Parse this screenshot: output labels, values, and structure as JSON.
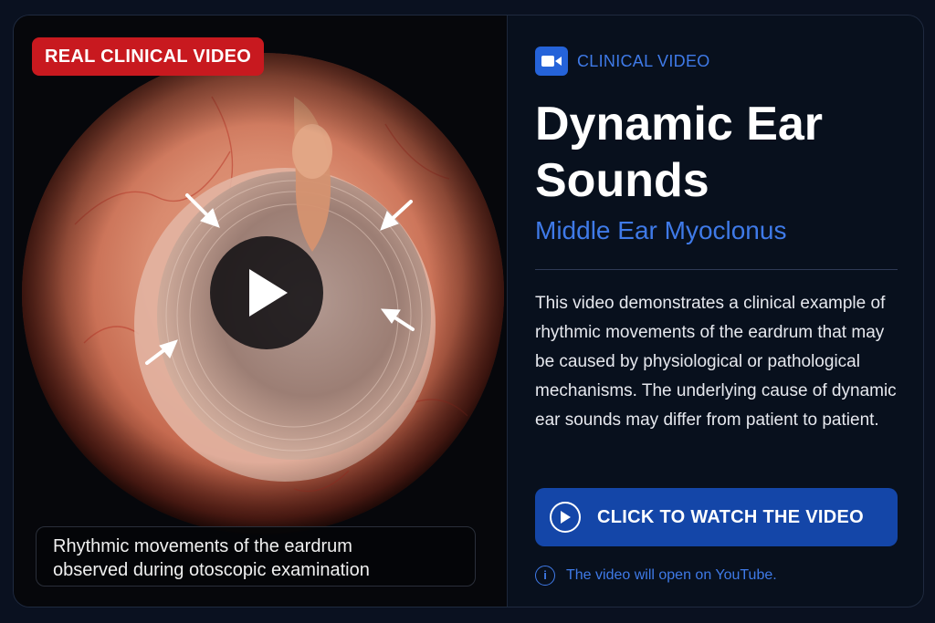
{
  "video": {
    "badge": "REAL CLINICAL VIDEO",
    "play_icon": "play-icon",
    "caption_line1": "Rhythmic movements of the eardrum",
    "caption_line2": "observed during otoscopic examination"
  },
  "info": {
    "tag_icon": "video-camera-icon",
    "tag_label": "CLINICAL VIDEO",
    "title": "Dynamic Ear Sounds",
    "subtitle": "Middle Ear Myoclonus",
    "description": "This video demonstrates a clinical example of rhythmic movements of the eardrum that may be caused by physiological or pathological mechanisms. The underlying cause of dynamic ear sounds may differ from patient to patient.",
    "cta_icon": "play-circle-icon",
    "cta_label": "CLICK TO WATCH THE VIDEO",
    "note_icon": "info-icon",
    "note": "The video will open on YouTube."
  },
  "colors": {
    "background": "#0a1120",
    "accent": "#3f7ae8",
    "badge": "#c8191f",
    "cta": "#1446a8"
  }
}
